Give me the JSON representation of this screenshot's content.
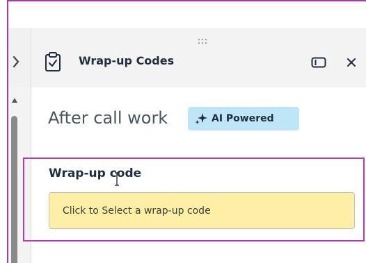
{
  "header": {
    "title": "Wrap-up Codes",
    "icons": [
      "clipboard-check-icon",
      "drag-handle-icon",
      "panel-toggle-icon",
      "close-icon"
    ]
  },
  "section": {
    "heading": "After call work",
    "badge": {
      "label": "AI Powered",
      "icon": "sparkle-icon",
      "color": "#bfe6f7"
    }
  },
  "wrapup_field": {
    "label": "Wrap-up code",
    "placeholder": "Click to Select a wrap-up code",
    "background": "#fdf0a6"
  },
  "colors": {
    "highlight": "#b43bb3",
    "header_bg": "#f3f3f3",
    "text": "#1f2d3d"
  }
}
